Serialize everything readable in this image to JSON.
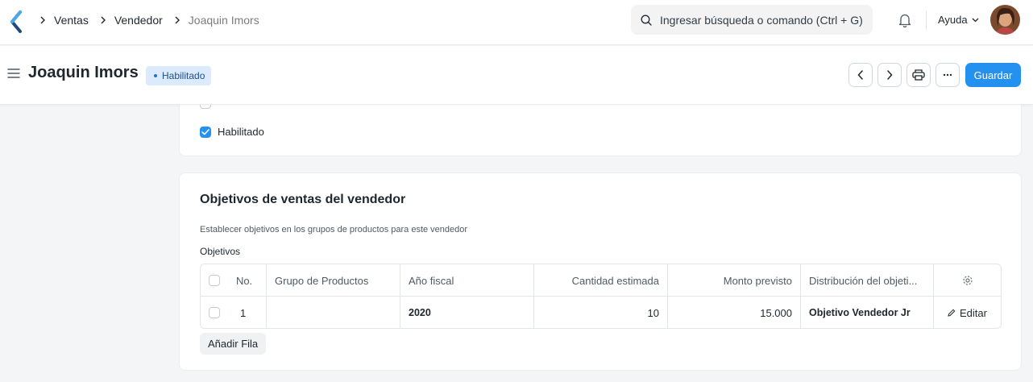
{
  "navbar": {
    "breadcrumbs": [
      "Ventas",
      "Vendedor",
      "Joaquin Imors"
    ],
    "search_placeholder": "Ingresar búsqueda o comando (Ctrl + G)",
    "help_label": "Ayuda"
  },
  "page": {
    "title": "Joaquin Imors",
    "status_badge": "Habilitado",
    "save_label": "Guardar"
  },
  "details": {
    "enabled_label": "Habilitado",
    "enabled_checked": true
  },
  "targets": {
    "section_title": "Objetivos de ventas del vendedor",
    "description": "Establecer objetivos en los grupos de productos para este vendedor",
    "table_label": "Objetivos",
    "columns": [
      "No.",
      "Grupo de Productos",
      "Año fiscal",
      "Cantidad estimada",
      "Monto previsto",
      "Distribución del objeti..."
    ],
    "rows": [
      {
        "no": "1",
        "item_group": "",
        "fiscal_year": "2020",
        "target_qty": "10",
        "target_amount": "15.000",
        "distribution": "Objetivo Vendedor Jr",
        "edit_label": "Editar"
      }
    ],
    "add_row_label": "Añadir Fila"
  },
  "colors": {
    "primary": "#2490ef",
    "badge_bg": "#dbeafd",
    "badge_text": "#1f4f8d"
  }
}
